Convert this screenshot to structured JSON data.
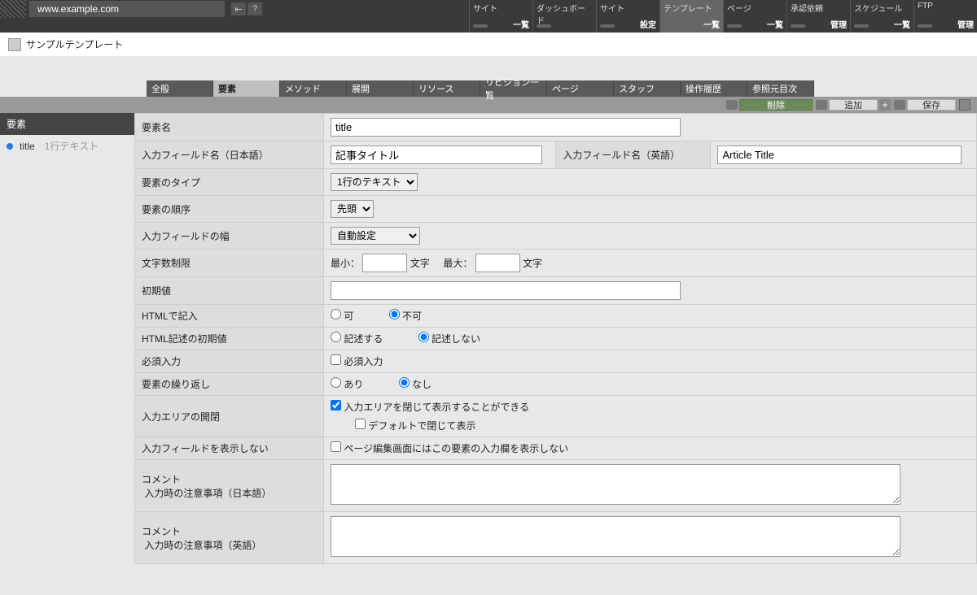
{
  "chrome": {
    "url": "www.example.com",
    "nav": [
      {
        "name": "サイト",
        "action": "一覧"
      },
      {
        "name": "ダッシュボード",
        "action": ""
      },
      {
        "name": "サイト",
        "action": "設定"
      },
      {
        "name": "テンプレート",
        "action": "一覧",
        "active": true
      },
      {
        "name": "ページ",
        "action": "一覧"
      },
      {
        "name": "承認依頼",
        "action": "管理"
      },
      {
        "name": "スケジュール",
        "action": "一覧"
      },
      {
        "name": "FTP",
        "action": "管理"
      }
    ]
  },
  "page_title": "サンプルテンプレート",
  "tabs": [
    "全般",
    "要素",
    "メソッド",
    "展開",
    "リソース",
    "リビジョン一覧",
    "ページ",
    "スタッフ",
    "操作履歴",
    "参照元目次"
  ],
  "active_tab": 1,
  "actions": {
    "delete": "削除",
    "add": "追加",
    "save": "保存"
  },
  "sidebar": {
    "header": "要素",
    "items": [
      {
        "name": "title",
        "type": "1行テキスト"
      }
    ]
  },
  "form": {
    "element_name": {
      "label": "要素名",
      "value": "title"
    },
    "field_ja": {
      "label": "入力フィールド名（日本語）",
      "value": "記事タイトル"
    },
    "field_en": {
      "label": "入力フィールド名（英語）",
      "value": "Article Title"
    },
    "type": {
      "label": "要素のタイプ",
      "value": "1行のテキスト"
    },
    "order": {
      "label": "要素の順序",
      "value": "先頭"
    },
    "width": {
      "label": "入力フィールドの幅",
      "value": "自動設定"
    },
    "char_limit": {
      "label": "文字数制限",
      "min_label": "最小：",
      "max_label": "最大：",
      "unit": "文字"
    },
    "initial": {
      "label": "初期値",
      "value": ""
    },
    "html_input": {
      "label": "HTMLで記入",
      "opt_yes": "可",
      "opt_no": "不可",
      "value": "不可"
    },
    "html_initial": {
      "label": "HTML記述の初期値",
      "opt_yes": "記述する",
      "opt_no": "記述しない",
      "value": "記述しない"
    },
    "required": {
      "label": "必須入力",
      "checkbox_label": "必須入力"
    },
    "repeat": {
      "label": "要素の繰り返し",
      "opt_yes": "あり",
      "opt_no": "なし",
      "value": "なし"
    },
    "collapse": {
      "label": "入力エリアの開閉",
      "cb1": "入力エリアを閉じて表示することができる",
      "cb2": "デフォルトで閉じて表示",
      "cb1_checked": true
    },
    "hide_field": {
      "label": "入力フィールドを表示しない",
      "cb": "ページ編集画面にはこの要素の入力欄を表示しない"
    },
    "comment_ja": {
      "label": "コメント",
      "sub": "入力時の注意事項（日本語）"
    },
    "comment_en": {
      "label": "コメント",
      "sub": "入力時の注意事項（英語）"
    }
  }
}
